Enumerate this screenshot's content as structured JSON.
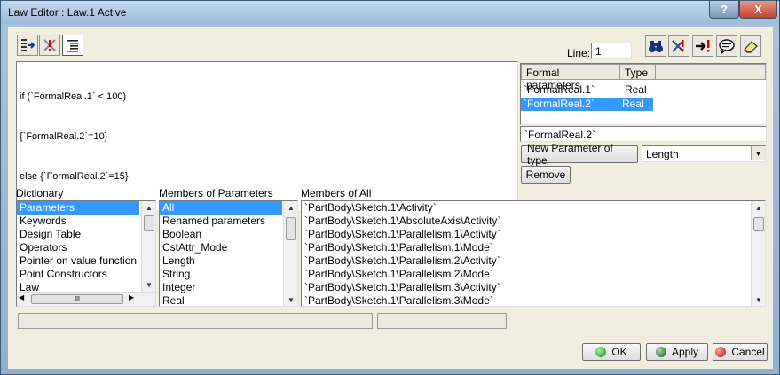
{
  "window": {
    "title": "Law Editor : Law.1 Active",
    "help": "?",
    "close": "X"
  },
  "toolbar": {
    "left_icons": [
      "import-icon",
      "error-icon",
      "text-align-icon"
    ],
    "line_label": "Line:",
    "line_value": "1",
    "right_icons": [
      "binoculars-icon",
      "diagnose-icon",
      "jump-error-icon",
      "comment-icon",
      "eraser-icon"
    ]
  },
  "editor": {
    "lines": [
      "if (`FormalReal.1` < 100)",
      "{`FormalReal.2`=10}",
      "else {`FormalReal.2`=15}"
    ]
  },
  "formal_params": {
    "headers": [
      "Formal parameters",
      "Type"
    ],
    "rows": [
      {
        "name": "`FormalReal.1`",
        "type": "Real",
        "selected": false
      },
      {
        "name": "`FormalReal.2`",
        "type": "Real",
        "selected": true
      }
    ],
    "selected_field": "`FormalReal.2`",
    "new_param_button": "New Parameter of type",
    "type_select": "Length",
    "remove_button": "Remove"
  },
  "dictionary": {
    "label": "Dictionary",
    "items": [
      "Parameters",
      "Keywords",
      "Design Table",
      "Operators",
      "Pointer on value function",
      "Point Constructors",
      "Law"
    ],
    "selected": 0
  },
  "members_params": {
    "label": "Members of Parameters",
    "items": [
      "All",
      "Renamed parameters",
      "Boolean",
      "CstAttr_Mode",
      "Length",
      "String",
      "Integer",
      "Real"
    ],
    "selected": 0
  },
  "members_all": {
    "label": "Members of All",
    "items": [
      "`PartBody\\Sketch.1\\Activity`",
      "`PartBody\\Sketch.1\\AbsoluteAxis\\Activity`",
      "`PartBody\\Sketch.1\\Parallelism.1\\Activity`",
      "`PartBody\\Sketch.1\\Parallelism.1\\Mode`",
      "`PartBody\\Sketch.1\\Parallelism.2\\Activity`",
      "`PartBody\\Sketch.1\\Parallelism.2\\Mode`",
      "`PartBody\\Sketch.1\\Parallelism.3\\Activity`",
      "`PartBody\\Sketch.1\\Parallelism.3\\Mode`"
    ]
  },
  "hscroll_thumb": "III",
  "buttons": {
    "ok": "OK",
    "apply": "Apply",
    "cancel": "Cancel"
  }
}
